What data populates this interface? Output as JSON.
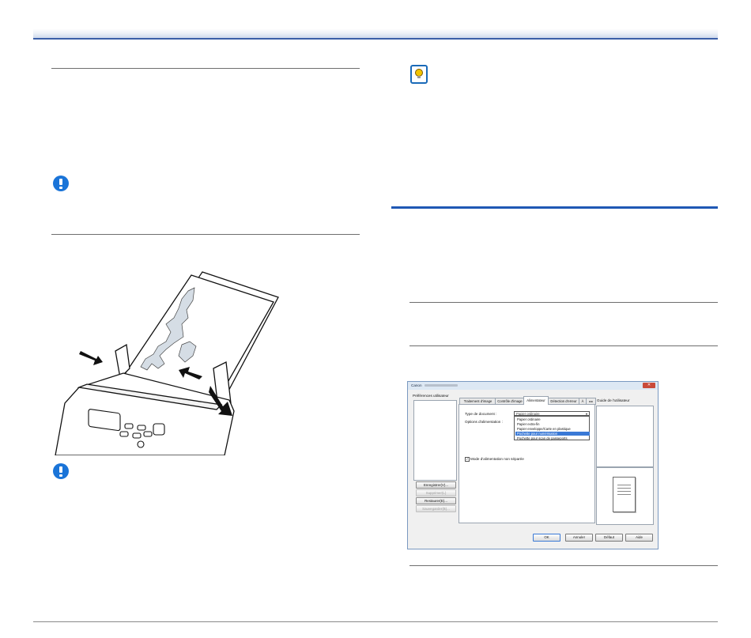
{
  "dialog": {
    "title": "Canon",
    "close_glyph": "✕",
    "user_preferences_label": "Préférences utilisateur",
    "buttons": {
      "save": "Enregistrer(V)...",
      "delete": "Supprimer(L)",
      "restore": "Restaurer(E)...",
      "backup": "Sauvegarder(B)..."
    },
    "tabs": [
      "Traitement d'image",
      "Contrôle d'image",
      "Alimentateur",
      "Détection d'erreur",
      "À"
    ],
    "active_tab": "Alimentateur",
    "tab_scroll_glyph": "◂ ▸",
    "document_type_label": "Type de document :",
    "document_type_value": "Papier ordinaire",
    "dropdown_arrow": "▾",
    "feed_options_label": "Options d'alimentation :",
    "document_type_options": [
      "Papier ordinaire",
      "Papier extra-fin",
      "Papier enveloppe/Carte en plastique",
      "Pochette pour numérisation",
      "Pochette pour scan de passeports"
    ],
    "selected_option": "Pochette pour numérisation",
    "nonsep_checkbox_checked": true,
    "checkbox_glyph": "✓",
    "nonsep_label": "Mode d'alimentation non séparée",
    "user_guide_label": "Guide de l'utilisateur",
    "footer_buttons": {
      "ok": "OK",
      "cancel": "Annuler",
      "default": "Défaut",
      "help": "Aide"
    }
  }
}
